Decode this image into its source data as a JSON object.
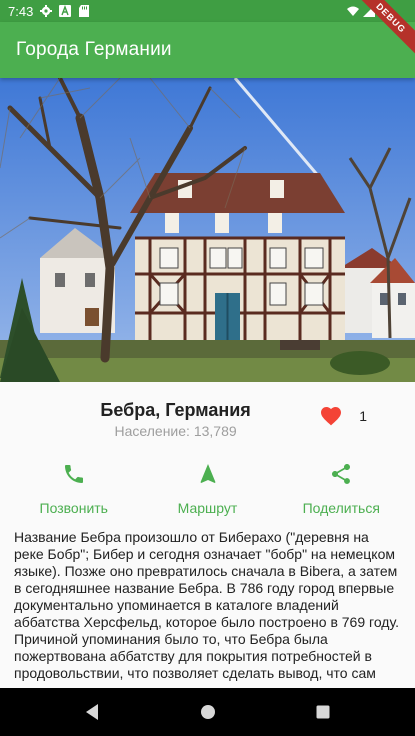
{
  "status_bar": {
    "time": "7:43",
    "icons": [
      "settings-icon",
      "font-a-icon",
      "sd-card-icon",
      "wifi-icon",
      "signal-icon",
      "battery-icon"
    ]
  },
  "app_bar": {
    "title": "Города Германии",
    "debug_banner": "DEBUG"
  },
  "city": {
    "name": "Бебра, Германия",
    "population": "Население: 13,789",
    "favorite_icon": "heart-icon",
    "favorite_count": "1"
  },
  "actions": [
    {
      "label": "Позвонить",
      "icon": "phone-icon"
    },
    {
      "label": "Маршрут",
      "icon": "navigation-icon"
    },
    {
      "label": "Поделиться",
      "icon": "share-icon"
    }
  ],
  "description": "Название Бебра произошло от Биберахо (\"деревня на реке Бобр\"; Бибер и сегодня означает \"бобр\" на немецком языке). Позже оно превратилось сначала в Bibera, а затем в сегодняшнее название Бебра. В 786 году город впервые документально упоминается в каталоге владений аббатства Херсфельд, которое было построено в 769 году. Причиной упоминания было то, что Бебра была пожертвована аббатству для покрытия потребностей в продовольствии, что позволяет сделать вывод, что сам справочник, а значит и существование",
  "colors": {
    "primary": "#4caf50",
    "status_bar": "#3f9e43",
    "heart": "#f44336",
    "debug": "#b5322a"
  },
  "nav_bar": {
    "icons": [
      "back-icon",
      "home-icon",
      "recents-icon"
    ]
  }
}
